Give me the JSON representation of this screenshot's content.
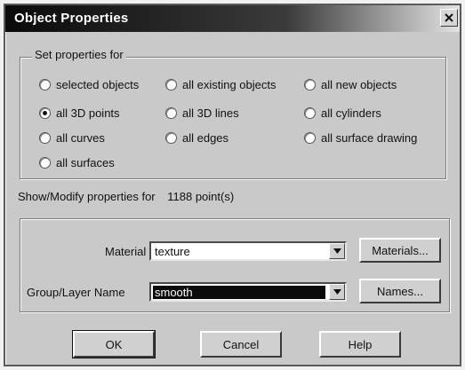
{
  "window": {
    "title": "Object Properties",
    "close_glyph": "x",
    "close_icon": "close-icon"
  },
  "set_properties": {
    "legend": "Set properties for",
    "options": [
      {
        "label": "selected objects",
        "checked": false
      },
      {
        "label": "all existing objects",
        "checked": false
      },
      {
        "label": "all new objects",
        "checked": false
      },
      {
        "label": "all 3D points",
        "checked": true
      },
      {
        "label": "all 3D lines",
        "checked": false
      },
      {
        "label": "all cylinders",
        "checked": false
      },
      {
        "label": "all curves",
        "checked": false
      },
      {
        "label": "all edges",
        "checked": false
      },
      {
        "label": "all surface drawing",
        "checked": false
      },
      {
        "label": "all surfaces",
        "checked": false
      }
    ]
  },
  "show_modify": {
    "label": "Show/Modify properties for",
    "count": "1188 point(s)"
  },
  "material": {
    "label": "Material",
    "value": "texture",
    "button": "Materials..."
  },
  "group_layer": {
    "label": "Group/Layer Name",
    "value": "smooth",
    "button": "Names..."
  },
  "buttons": {
    "ok": "OK",
    "cancel": "Cancel",
    "help": "Help"
  },
  "colors": {
    "dialog_bg": "#c9c9c9",
    "title_text": "#ffffff",
    "selected_field_bg": "#0a0a0a"
  }
}
